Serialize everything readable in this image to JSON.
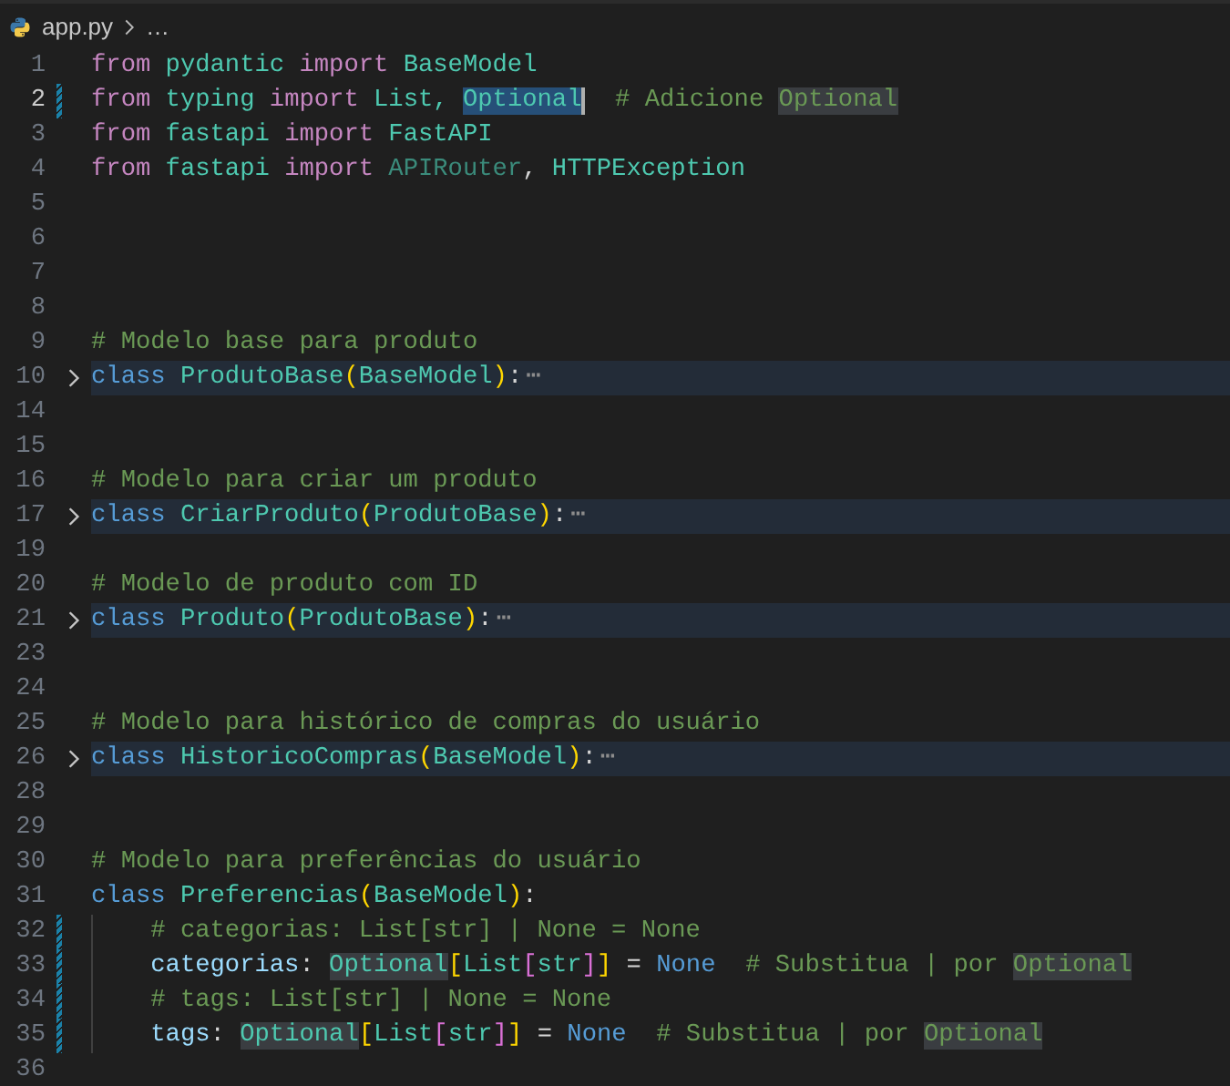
{
  "breadcrumb": {
    "file": "app.py",
    "more": "…"
  },
  "lines": [
    {
      "number": "1",
      "current": false,
      "modified": false,
      "folded": false,
      "tokens": [
        {
          "text": "from",
          "kind": "keyword"
        },
        {
          "text": " pydantic",
          "kind": "module"
        },
        {
          "text": " import",
          "kind": "keyword"
        },
        {
          "text": " BaseModel",
          "kind": "type"
        }
      ]
    },
    {
      "number": "2",
      "current": true,
      "modified": true,
      "folded": false,
      "tokens": [
        {
          "text": "from",
          "kind": "keyword"
        },
        {
          "text": " typing",
          "kind": "module"
        },
        {
          "text": " import",
          "kind": "keyword"
        },
        {
          "text": " List, ",
          "kind": "type"
        },
        {
          "text": "Optional",
          "kind": "selection"
        },
        {
          "text": "  # Adicione ",
          "kind": "comment"
        },
        {
          "text": "Optional",
          "kind": "commentmatch"
        }
      ]
    },
    {
      "number": "3",
      "current": false,
      "modified": false,
      "folded": false,
      "tokens": [
        {
          "text": "from",
          "kind": "keyword"
        },
        {
          "text": " fastapi",
          "kind": "module"
        },
        {
          "text": " import",
          "kind": "keyword"
        },
        {
          "text": " FastAPI",
          "kind": "type"
        }
      ]
    },
    {
      "number": "4",
      "current": false,
      "modified": false,
      "folded": false,
      "tokens": [
        {
          "text": "from",
          "kind": "keyword"
        },
        {
          "text": " fastapi",
          "kind": "module"
        },
        {
          "text": " import",
          "kind": "keyword"
        },
        {
          "text": " APIRouter",
          "kind": "unused"
        },
        {
          "text": ", ",
          "kind": "plain"
        },
        {
          "text": "HTTPException",
          "kind": "type"
        }
      ]
    },
    {
      "number": "5",
      "current": false,
      "modified": false,
      "folded": false
    },
    {
      "number": "6",
      "current": false,
      "modified": false,
      "folded": false
    },
    {
      "number": "7",
      "current": false,
      "modified": false,
      "folded": false
    },
    {
      "number": "8",
      "current": false,
      "modified": false,
      "folded": false
    },
    {
      "number": "9",
      "current": false,
      "modified": false,
      "folded": false,
      "tokens": [
        {
          "text": "# Modelo base para produto",
          "kind": "comment"
        }
      ]
    },
    {
      "number": "10",
      "current": false,
      "modified": false,
      "folded": true,
      "tokens": [
        {
          "text": "class",
          "kind": "storage"
        },
        {
          "text": " ProdutoBase",
          "kind": "type"
        },
        {
          "text": "(",
          "kind": "gold"
        },
        {
          "text": "BaseModel",
          "kind": "type"
        },
        {
          "text": ")",
          "kind": "gold"
        },
        {
          "text": ":",
          "kind": "plain"
        },
        {
          "text": "⋯",
          "kind": "ellipsis"
        }
      ]
    },
    {
      "number": "14",
      "current": false,
      "modified": false,
      "folded": false
    },
    {
      "number": "15",
      "current": false,
      "modified": false,
      "folded": false
    },
    {
      "number": "16",
      "current": false,
      "modified": false,
      "folded": false,
      "tokens": [
        {
          "text": "# Modelo para criar um produto",
          "kind": "comment"
        }
      ]
    },
    {
      "number": "17",
      "current": false,
      "modified": false,
      "folded": true,
      "tokens": [
        {
          "text": "class",
          "kind": "storage"
        },
        {
          "text": " CriarProduto",
          "kind": "type"
        },
        {
          "text": "(",
          "kind": "gold"
        },
        {
          "text": "ProdutoBase",
          "kind": "type"
        },
        {
          "text": ")",
          "kind": "gold"
        },
        {
          "text": ":",
          "kind": "plain"
        },
        {
          "text": "⋯",
          "kind": "ellipsis"
        }
      ]
    },
    {
      "number": "19",
      "current": false,
      "modified": false,
      "folded": false
    },
    {
      "number": "20",
      "current": false,
      "modified": false,
      "folded": false,
      "tokens": [
        {
          "text": "# Modelo de produto com ID",
          "kind": "comment"
        }
      ]
    },
    {
      "number": "21",
      "current": false,
      "modified": false,
      "folded": true,
      "tokens": [
        {
          "text": "class",
          "kind": "storage"
        },
        {
          "text": " Produto",
          "kind": "type"
        },
        {
          "text": "(",
          "kind": "gold"
        },
        {
          "text": "ProdutoBase",
          "kind": "type"
        },
        {
          "text": ")",
          "kind": "gold"
        },
        {
          "text": ":",
          "kind": "plain"
        },
        {
          "text": "⋯",
          "kind": "ellipsis"
        }
      ]
    },
    {
      "number": "23",
      "current": false,
      "modified": false,
      "folded": false
    },
    {
      "number": "24",
      "current": false,
      "modified": false,
      "folded": false
    },
    {
      "number": "25",
      "current": false,
      "modified": false,
      "folded": false,
      "tokens": [
        {
          "text": "# Modelo para histórico de compras do usuário",
          "kind": "comment"
        }
      ]
    },
    {
      "number": "26",
      "current": false,
      "modified": false,
      "folded": true,
      "tokens": [
        {
          "text": "class",
          "kind": "storage"
        },
        {
          "text": " HistoricoCompras",
          "kind": "type"
        },
        {
          "text": "(",
          "kind": "gold"
        },
        {
          "text": "BaseModel",
          "kind": "type"
        },
        {
          "text": ")",
          "kind": "gold"
        },
        {
          "text": ":",
          "kind": "plain"
        },
        {
          "text": "⋯",
          "kind": "ellipsis"
        }
      ]
    },
    {
      "number": "28",
      "current": false,
      "modified": false,
      "folded": false
    },
    {
      "number": "29",
      "current": false,
      "modified": false,
      "folded": false
    },
    {
      "number": "30",
      "current": false,
      "modified": false,
      "folded": false,
      "tokens": [
        {
          "text": "# Modelo para preferências do usuário",
          "kind": "comment"
        }
      ]
    },
    {
      "number": "31",
      "current": false,
      "modified": false,
      "folded": false,
      "tokens": [
        {
          "text": "class",
          "kind": "storage"
        },
        {
          "text": " Preferencias",
          "kind": "type"
        },
        {
          "text": "(",
          "kind": "gold"
        },
        {
          "text": "BaseModel",
          "kind": "type"
        },
        {
          "text": ")",
          "kind": "gold"
        },
        {
          "text": ":",
          "kind": "plain"
        }
      ]
    },
    {
      "number": "32",
      "current": false,
      "modified": true,
      "folded": false,
      "tokens": [
        {
          "text": "    # categorias: List[str] | None = None",
          "kind": "comment"
        }
      ]
    },
    {
      "number": "33",
      "current": false,
      "modified": true,
      "folded": false,
      "tokens": [
        {
          "text": "    categorias",
          "kind": "variable"
        },
        {
          "text": ": ",
          "kind": "plain"
        },
        {
          "text": "Optional",
          "kind": "match"
        },
        {
          "text": "[",
          "kind": "gold"
        },
        {
          "text": "List",
          "kind": "type"
        },
        {
          "text": "[",
          "kind": "pink"
        },
        {
          "text": "str",
          "kind": "type"
        },
        {
          "text": "]",
          "kind": "pink"
        },
        {
          "text": "]",
          "kind": "gold"
        },
        {
          "text": " = ",
          "kind": "plain"
        },
        {
          "text": "None",
          "kind": "constant"
        },
        {
          "text": "  # Substitua | por ",
          "kind": "comment"
        },
        {
          "text": "Optional",
          "kind": "commentmatch"
        }
      ]
    },
    {
      "number": "34",
      "current": false,
      "modified": true,
      "folded": false,
      "tokens": [
        {
          "text": "    # tags: List[str] | None = None",
          "kind": "comment"
        }
      ]
    },
    {
      "number": "35",
      "current": false,
      "modified": true,
      "folded": false,
      "tokens": [
        {
          "text": "    tags",
          "kind": "variable"
        },
        {
          "text": ": ",
          "kind": "plain"
        },
        {
          "text": "Optional",
          "kind": "match"
        },
        {
          "text": "[",
          "kind": "gold"
        },
        {
          "text": "List",
          "kind": "type"
        },
        {
          "text": "[",
          "kind": "pink"
        },
        {
          "text": "str",
          "kind": "type"
        },
        {
          "text": "]",
          "kind": "pink"
        },
        {
          "text": "]",
          "kind": "gold"
        },
        {
          "text": " = ",
          "kind": "plain"
        },
        {
          "text": "None",
          "kind": "constant"
        },
        {
          "text": "  # Substitua | por ",
          "kind": "comment"
        },
        {
          "text": "Optional",
          "kind": "commentmatch"
        }
      ]
    },
    {
      "number": "36",
      "current": false,
      "modified": false,
      "folded": false
    }
  ]
}
